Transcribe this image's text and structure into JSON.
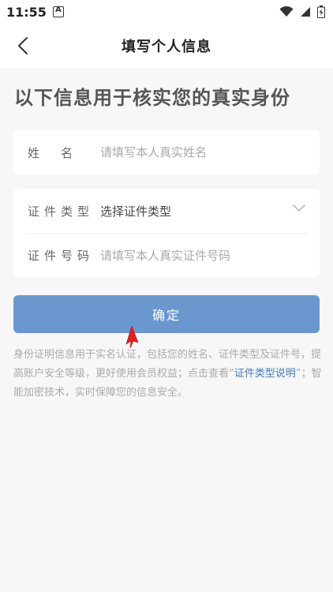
{
  "status_bar": {
    "time": "11:55",
    "icons": [
      "notification-a-icon",
      "wifi-icon",
      "signal-icon",
      "battery-charging-icon"
    ]
  },
  "nav": {
    "title": "填写个人信息",
    "back_icon": "chevron-left-icon"
  },
  "headline": "以下信息用于核实您的真实身份",
  "form": {
    "name": {
      "label": "姓　名",
      "placeholder": "请填写本人真实姓名"
    },
    "id_type": {
      "label": "证件类型",
      "value": "选择证件类型",
      "icon": "chevron-down-icon"
    },
    "id_number": {
      "label": "证件号码",
      "placeholder": "请填写本人真实证件号码"
    }
  },
  "confirm_label": "确定",
  "note": {
    "text_before": "身份证明信息用于实名认证，包括您的姓名、证件类型及证件号，提高账户安全等级，更好使用会员权益；点击查看“",
    "link": "证件类型说明",
    "text_after": "”；智能加密技术，实时保障您的信息安全。"
  },
  "colors": {
    "primary_button": "#6b97cf",
    "link": "#4a79b8",
    "cursor": "#e02020"
  }
}
